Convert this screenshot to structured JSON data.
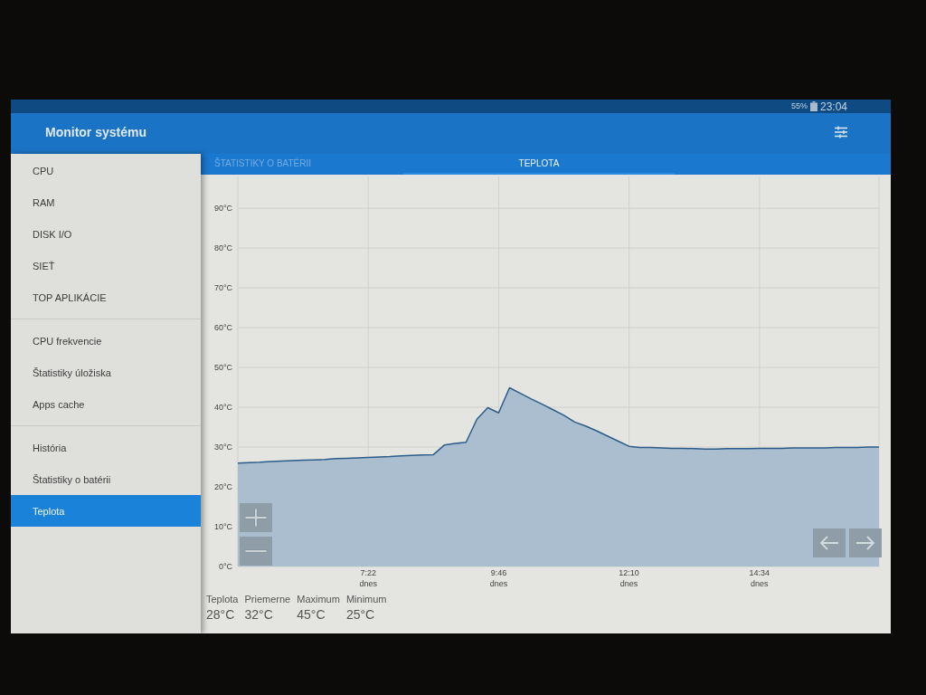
{
  "status_bar": {
    "battery": "55%",
    "time": "23:04"
  },
  "app_bar": {
    "title": "Monitor systému"
  },
  "drawer": {
    "sections": [
      {
        "items": [
          {
            "label": "CPU",
            "selected": false
          },
          {
            "label": "RAM",
            "selected": false
          },
          {
            "label": "DISK I/O",
            "selected": false
          },
          {
            "label": "SIEŤ",
            "selected": false
          },
          {
            "label": "TOP APLIKÁCIE",
            "selected": false
          }
        ]
      },
      {
        "items": [
          {
            "label": "CPU frekvencie",
            "selected": false
          },
          {
            "label": "Štatistiky úložiska",
            "selected": false
          },
          {
            "label": "Apps cache",
            "selected": false
          }
        ]
      },
      {
        "items": [
          {
            "label": "História",
            "selected": false
          },
          {
            "label": "Štatistiky o batérii",
            "selected": false
          },
          {
            "label": "Teplota",
            "selected": true
          }
        ]
      }
    ]
  },
  "tabs": [
    {
      "label": "ŠTATISTIKY O BATÉRII",
      "selected": false
    },
    {
      "label": "TEPLOTA",
      "selected": true
    }
  ],
  "chart": {
    "chart_data": {
      "type": "area",
      "grid": true,
      "categories": [
        null,
        null,
        null,
        null,
        null,
        null,
        null,
        null,
        null,
        null,
        null,
        null,
        "7:22\ndnes",
        null,
        null,
        null,
        null,
        null,
        null,
        null,
        null,
        null,
        null,
        null,
        "9:46\ndnes",
        null,
        null,
        null,
        null,
        null,
        null,
        null,
        null,
        null,
        null,
        null,
        "12:10\ndnes",
        null,
        null,
        null,
        null,
        null,
        null,
        null,
        null,
        null,
        null,
        null,
        "14:34\ndnes",
        null,
        null,
        null,
        null,
        null,
        null,
        null,
        null,
        null,
        null,
        null
      ],
      "series": [
        {
          "color": "#2c5d8a",
          "values": [
            26.0,
            26.1,
            26.2,
            26.4,
            26.5,
            26.6,
            26.7,
            26.8,
            26.9,
            27.1,
            27.2,
            27.3,
            27.4,
            27.5,
            27.6,
            27.8,
            27.9,
            28.0,
            28.1,
            30.5,
            30.9,
            31.2,
            37.0,
            39.9,
            38.6,
            44.9,
            43.5,
            42.1,
            40.8,
            39.4,
            38.0,
            36.3,
            35.3,
            34.1,
            32.8,
            31.5,
            30.2,
            29.9,
            29.9,
            29.8,
            29.7,
            29.7,
            29.6,
            29.5,
            29.5,
            29.6,
            29.6,
            29.6,
            29.7,
            29.7,
            29.7,
            29.8,
            29.8,
            29.8,
            29.8,
            29.9,
            29.9,
            29.9,
            30.0,
            30.0
          ]
        }
      ],
      "ylim": [
        0,
        98
      ],
      "yticks": [
        {
          "value": 0,
          "label": "0°C"
        },
        {
          "value": 10,
          "label": "10°C"
        },
        {
          "value": 20,
          "label": "20°C"
        },
        {
          "value": 30,
          "label": "30°C"
        },
        {
          "value": 40,
          "label": "40°C"
        },
        {
          "value": 50,
          "label": "50°C"
        },
        {
          "value": 60,
          "label": "60°C"
        },
        {
          "value": 70,
          "label": "70°C"
        },
        {
          "value": 80,
          "label": "80°C"
        },
        {
          "value": 90,
          "label": "90°C"
        }
      ]
    }
  },
  "stats": [
    {
      "label": "Teplota",
      "value": "28°C"
    },
    {
      "label": "Priemerne",
      "value": "32°C"
    },
    {
      "label": "Maximum",
      "value": "45°C"
    },
    {
      "label": "Minimum",
      "value": "25°C"
    }
  ]
}
